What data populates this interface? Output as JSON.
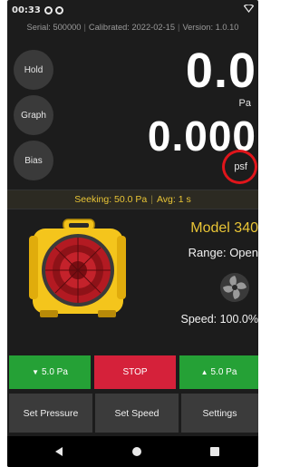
{
  "status_bar": {
    "time": "00:33",
    "left_icons": [
      "settings-notification-icon",
      "notification-icon"
    ],
    "right_icon": "wifi-icon"
  },
  "info": {
    "serial": "Serial: 500000",
    "calibrated": "Calibrated: 2022-02-15",
    "version": "Version: 1.0.10"
  },
  "side_buttons": {
    "hold": "Hold",
    "graph": "Graph",
    "bias": "Bias"
  },
  "readout": {
    "primary_value": "0.0",
    "primary_unit": "Pa",
    "secondary_value": "0.000",
    "secondary_unit": "psf",
    "highlight_color": "#e0151b"
  },
  "seek": {
    "seeking": "Seeking: 50.0 Pa",
    "avg": "Avg: 1 s",
    "color": "#e9c536"
  },
  "device": {
    "model": "Model 340",
    "range": "Range: Open",
    "speed": "Speed: 100.0%"
  },
  "controls": {
    "decrease": "5.0 Pa",
    "stop": "STOP",
    "increase": "5.0 Pa",
    "green": "#25a136",
    "red": "#d5213a"
  },
  "nav": {
    "set_pressure": "Set Pressure",
    "set_speed": "Set Speed",
    "settings": "Settings"
  }
}
